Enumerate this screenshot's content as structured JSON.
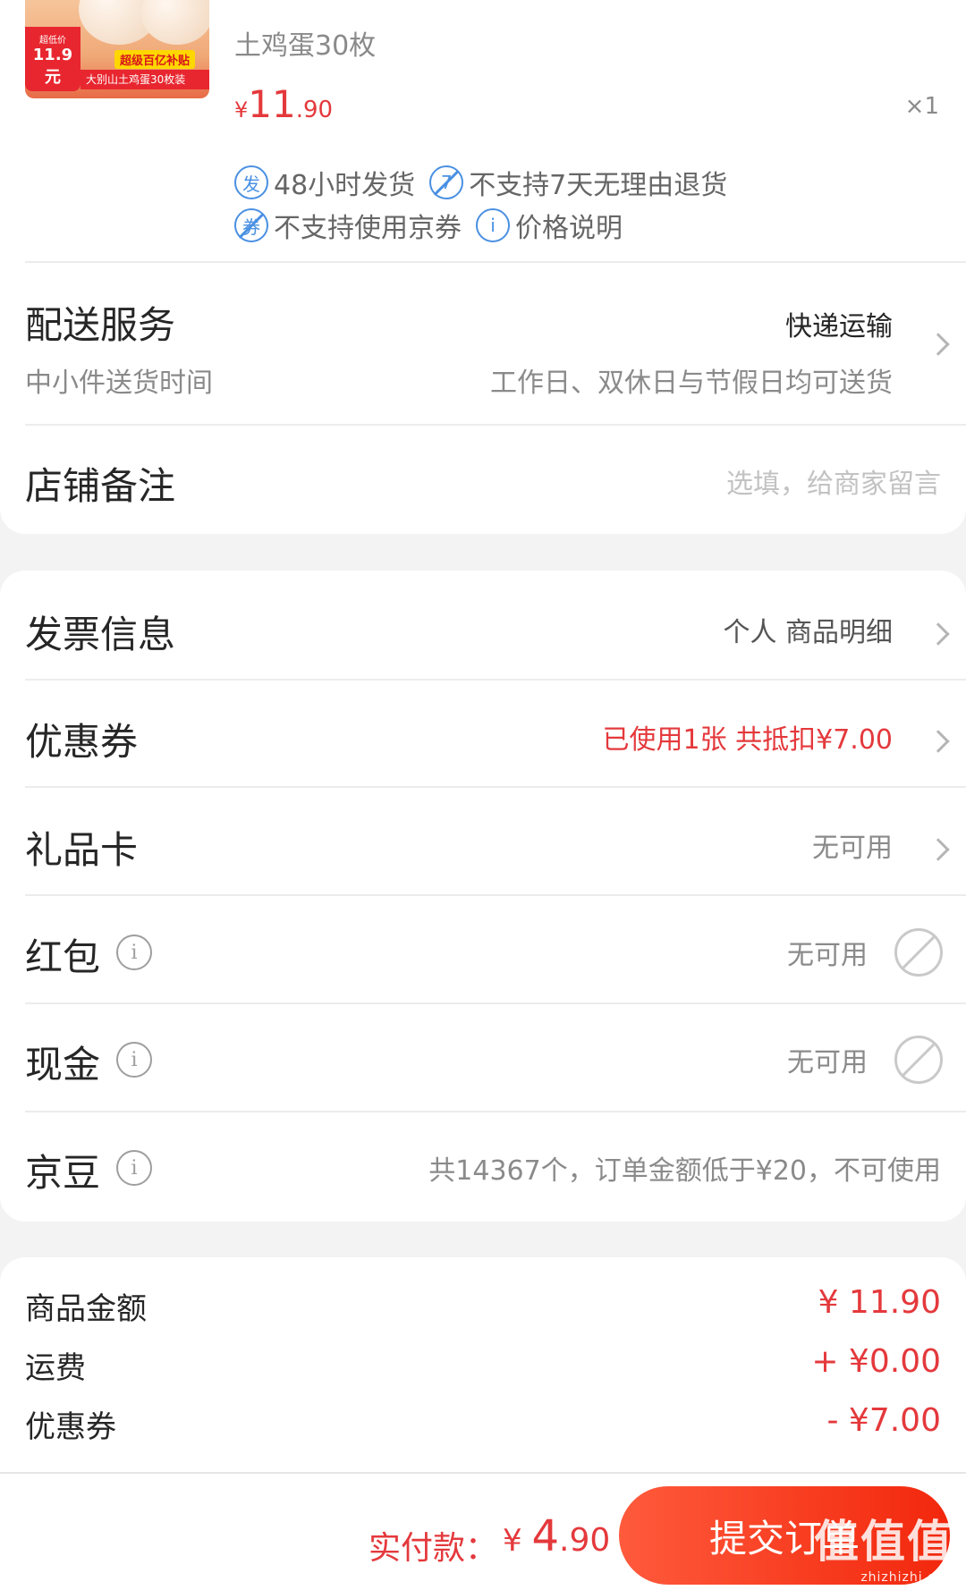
{
  "product": {
    "thumb": {
      "price_label": "超低价",
      "price": "11.9元",
      "subsidy": "超级百亿补贴",
      "caption": "大别山土鸡蛋30枚装"
    },
    "spec": "土鸡蛋30枚",
    "price": {
      "symbol": "¥",
      "int": "11",
      "dec": ".90"
    },
    "quantity": "×1",
    "tags": [
      {
        "icon": "发",
        "text": "48小时发货"
      },
      {
        "icon": "7",
        "text": "不支持7天无理由退货"
      },
      {
        "icon": "券",
        "text": "不支持使用京券"
      },
      {
        "icon": "i",
        "text": "价格说明"
      }
    ]
  },
  "delivery": {
    "title": "配送服务",
    "value": "快递运输",
    "sub_label": "中小件送货时间",
    "sub_value": "工作日、双休日与节假日均可送货"
  },
  "note": {
    "title": "店铺备注",
    "placeholder": "选填，给商家留言"
  },
  "invoice": {
    "title": "发票信息",
    "value": "个人 商品明细"
  },
  "coupon": {
    "title": "优惠券",
    "value": "已使用1张 共抵扣¥7.00"
  },
  "gift_card": {
    "title": "礼品卡",
    "value": "无可用"
  },
  "red_packet": {
    "title": "红包",
    "value": "无可用"
  },
  "cash": {
    "title": "现金",
    "value": "无可用"
  },
  "jingdou": {
    "title": "京豆",
    "value": "共14367个，订单金额低于¥20，不可使用"
  },
  "summary": [
    {
      "label": "商品金额",
      "value": "¥ 11.90"
    },
    {
      "label": "运费",
      "value": "+ ¥0.00"
    },
    {
      "label": "优惠券",
      "value": "- ¥7.00"
    }
  ],
  "footer": {
    "pay_label": "实付款：",
    "pay_amount": {
      "symbol": "¥ ",
      "int": "4",
      "dec": ".90"
    },
    "submit": "提交订单",
    "watermark": "值值值",
    "watermark_url": "zhizhizhi.com"
  },
  "colors": {
    "accent": "#e4393c",
    "button": "#f2270c",
    "tag_blue": "#4a90e2"
  }
}
